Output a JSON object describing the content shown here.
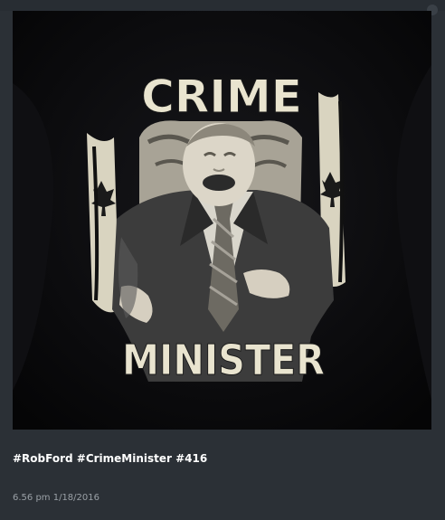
{
  "post": {
    "image": {
      "headline_top": "CRIME",
      "headline_bottom": "MINISTER"
    },
    "caption": "#RobFord #CrimeMinister #416",
    "timestamp": "6.56 pm 1/18/2016"
  },
  "colors": {
    "background": "#2b3036",
    "caption_text": "#ffffff",
    "timestamp_text": "#9aa0a6",
    "shirt_print": "#e9e4cf"
  }
}
